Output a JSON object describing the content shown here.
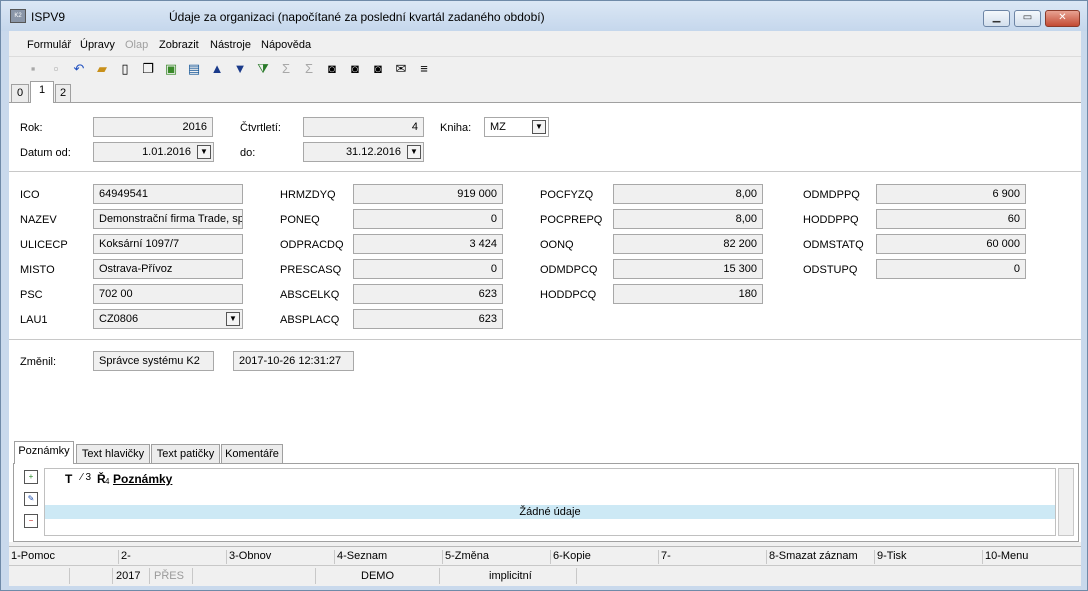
{
  "window": {
    "app_name": "ISPV9",
    "title": "Údaje za organizaci (napočítané za poslední kvartál zadaného období)",
    "app_icon_text": "K2"
  },
  "menu": [
    "Formulář",
    "Úpravy",
    "Olap",
    "Zobrazit",
    "Nástroje",
    "Nápověda"
  ],
  "toolbar_icons": [
    "save-icon",
    "save-as-icon",
    "undo-icon",
    "open-folder-icon",
    "new-document-icon",
    "copy-icon",
    "lock-icon",
    "book-icon",
    "arrow-up-icon",
    "arrow-down-icon",
    "filter-icon",
    "sum-icon",
    "sum-filter-icon",
    "binoculars-icon",
    "binoculars-back-icon",
    "binoculars-forward-icon",
    "envelope-icon",
    "menu-lines-icon"
  ],
  "tabs": [
    "0",
    "1",
    "2"
  ],
  "header": {
    "rok_label": "Rok:",
    "rok_value": "2016",
    "ctvrtleti_label": "Čtvrtletí:",
    "ctvrtleti_value": "4",
    "kniha_label": "Kniha:",
    "kniha_value": "MZ",
    "datum_od_label": "Datum od:",
    "datum_od_value": "1.01.2016",
    "do_label": "do:",
    "do_value": "31.12.2016"
  },
  "col1": [
    {
      "label": "ICO",
      "value": "64949541"
    },
    {
      "label": "NAZEV",
      "value": "Demonstrační firma Trade, sp"
    },
    {
      "label": "ULICECP",
      "value": "Koksární 1097/7"
    },
    {
      "label": "MISTO",
      "value": "Ostrava-Přívoz"
    },
    {
      "label": "PSC",
      "value": "702 00"
    },
    {
      "label": "LAU1",
      "value": "CZ0806"
    }
  ],
  "col2": [
    {
      "label": "HRMZDYQ",
      "value": "919 000"
    },
    {
      "label": "PONEQ",
      "value": "0"
    },
    {
      "label": "ODPRACDQ",
      "value": "3 424"
    },
    {
      "label": "PRESCASQ",
      "value": "0"
    },
    {
      "label": "ABSCELKQ",
      "value": "623"
    },
    {
      "label": "ABSPLACQ",
      "value": "623"
    }
  ],
  "col3": [
    {
      "label": "POCFYZQ",
      "value": "8,00"
    },
    {
      "label": "POCPREPQ",
      "value": "8,00"
    },
    {
      "label": "OONQ",
      "value": "82 200"
    },
    {
      "label": "ODMDPCQ",
      "value": "15 300"
    },
    {
      "label": "HODDPCQ",
      "value": "180"
    }
  ],
  "col4": [
    {
      "label": "ODMDPPQ",
      "value": "6 900"
    },
    {
      "label": "HODDPPQ",
      "value": "60"
    },
    {
      "label": "ODMSTATQ",
      "value": "60 000"
    },
    {
      "label": "ODSTUPQ",
      "value": "0"
    }
  ],
  "changed": {
    "label": "Změnil:",
    "user": "Správce systému K2",
    "timestamp": "2017-10-26 12:31:27"
  },
  "bottom_tabs": [
    "Poznámky",
    "Text hlavičky",
    "Text patičky",
    "Komentáře"
  ],
  "notes_grid": {
    "col_t": "T",
    "col_3": "⁄ 3",
    "col_r": "Ř",
    "col_r_sub": "4",
    "col_notes": "Poznámky",
    "empty": "Žádné údaje"
  },
  "fkeys": [
    "1-Pomoc",
    "2-",
    "3-Obnov",
    "4-Seznam",
    "5-Změna",
    "6-Kopie",
    "7-",
    "8-Smazat záznam",
    "9-Tisk",
    "10-Menu"
  ],
  "status": {
    "year": "2017",
    "mode": "PŘES",
    "db": "DEMO",
    "profile": "implicitní"
  }
}
